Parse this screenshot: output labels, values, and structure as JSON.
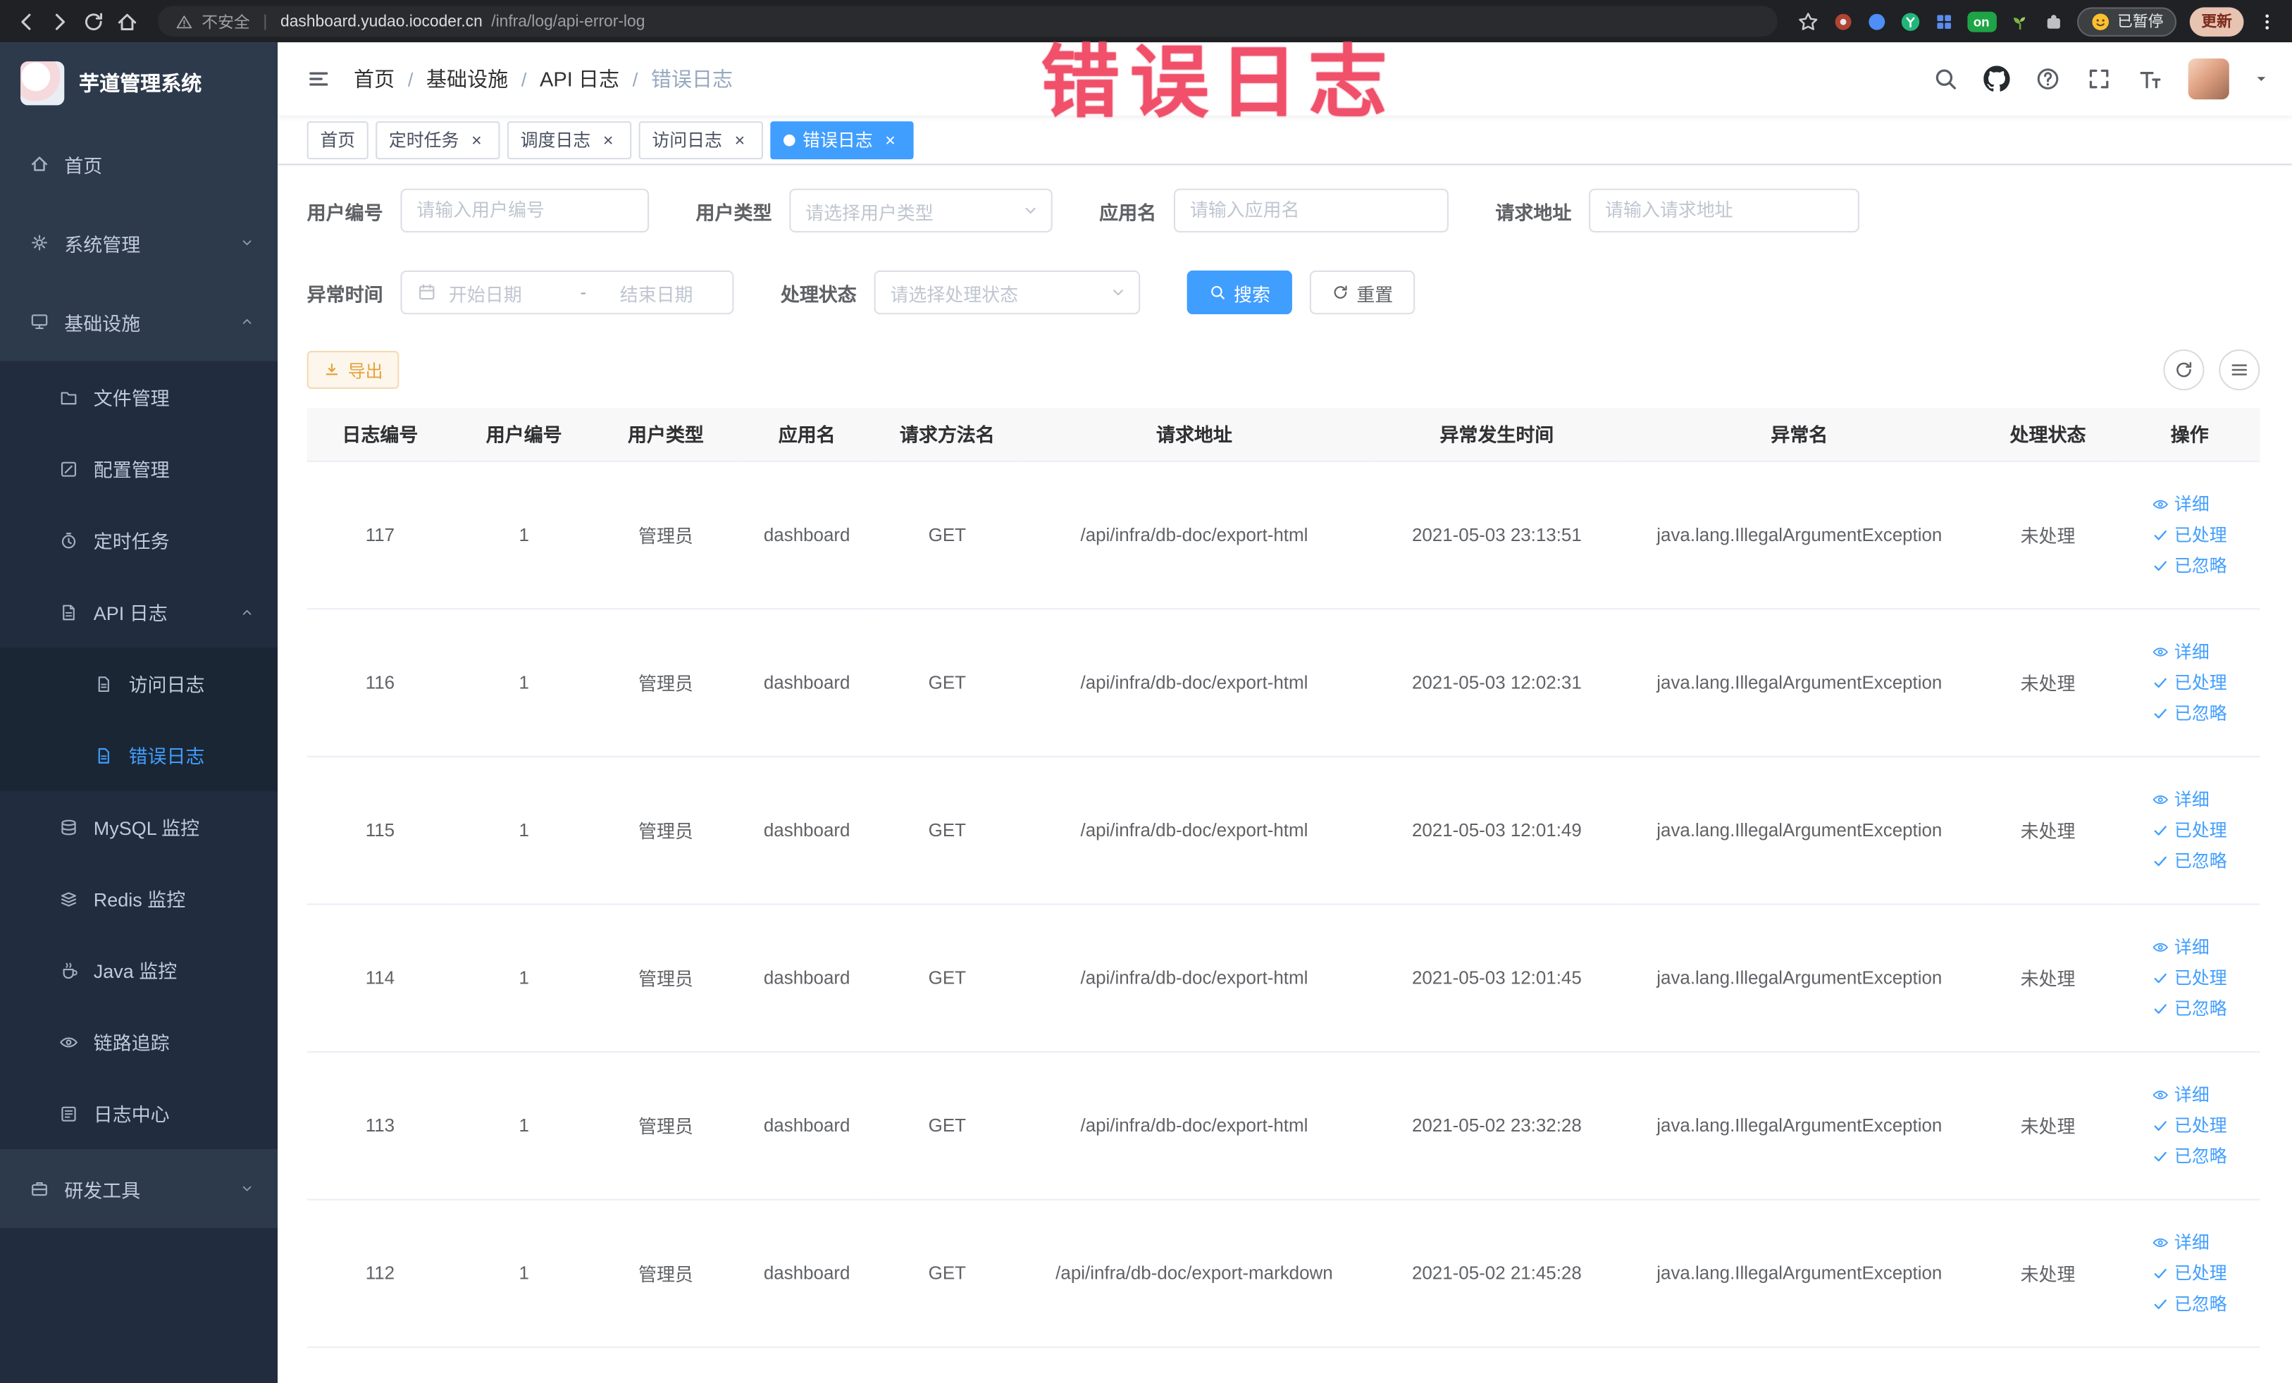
{
  "browser": {
    "security_label": "不安全",
    "url_domain": "dashboard.yudao.iocoder.cn",
    "url_path": "/infra/log/api-error-log",
    "url_separator": "|",
    "extensions_badge_on": "on",
    "paused_chip_label": "已暂停",
    "update_chip_label": "更新"
  },
  "annotation_text": "错误日志",
  "sidebar": {
    "logo_title": "芋道管理系统",
    "menu": [
      {
        "name": "home",
        "label": "首页",
        "icon": "home-icon",
        "level": 1,
        "expandable": false
      },
      {
        "name": "system-mgmt",
        "label": "系统管理",
        "icon": "gear-icon",
        "level": 1,
        "expandable": true,
        "expanded": false
      },
      {
        "name": "infrastructure",
        "label": "基础设施",
        "icon": "infra-icon",
        "level": 1,
        "expandable": true,
        "expanded": true
      },
      {
        "name": "file-mgmt",
        "label": "文件管理",
        "icon": "file-icon",
        "level": 2
      },
      {
        "name": "config-mgmt",
        "label": "配置管理",
        "icon": "config-icon",
        "level": 2
      },
      {
        "name": "scheduled-tasks",
        "label": "定时任务",
        "icon": "timer-icon",
        "level": 2
      },
      {
        "name": "api-log",
        "label": "API 日志",
        "icon": "api-log-icon",
        "level": 2,
        "expandable": true,
        "expanded": true
      },
      {
        "name": "access-log",
        "label": "访问日志",
        "icon": "doc-icon",
        "level": 3
      },
      {
        "name": "error-log",
        "label": "错误日志",
        "icon": "doc-icon",
        "level": 3,
        "active": true
      },
      {
        "name": "mysql-monitor",
        "label": "MySQL 监控",
        "icon": "mysql-icon",
        "level": 2
      },
      {
        "name": "redis-monitor",
        "label": "Redis 监控",
        "icon": "redis-icon",
        "level": 2
      },
      {
        "name": "java-monitor",
        "label": "Java 监控",
        "icon": "java-icon",
        "level": 2
      },
      {
        "name": "trace",
        "label": "链路追踪",
        "icon": "trace-icon",
        "level": 2
      },
      {
        "name": "log-center",
        "label": "日志中心",
        "icon": "log-center-icon",
        "level": 2
      },
      {
        "name": "dev-tools",
        "label": "研发工具",
        "icon": "tools-icon",
        "level": 1,
        "expandable": true,
        "expanded": false
      }
    ]
  },
  "header": {
    "breadcrumb": [
      "首页",
      "基础设施",
      "API 日志",
      "错误日志"
    ],
    "breadcrumb_separator": "/"
  },
  "tabs": [
    {
      "name": "home",
      "label": "首页",
      "closable": false,
      "active": false
    },
    {
      "name": "scheduled-tasks",
      "label": "定时任务",
      "closable": true,
      "active": false
    },
    {
      "name": "schedule-log",
      "label": "调度日志",
      "closable": true,
      "active": false
    },
    {
      "name": "access-log",
      "label": "访问日志",
      "closable": true,
      "active": false
    },
    {
      "name": "error-log",
      "label": "错误日志",
      "closable": true,
      "active": true
    }
  ],
  "filters": {
    "user_id": {
      "label": "用户编号",
      "placeholder": "请输入用户编号",
      "value": ""
    },
    "user_type": {
      "label": "用户类型",
      "placeholder": "请选择用户类型",
      "value": ""
    },
    "app_name": {
      "label": "应用名",
      "placeholder": "请输入应用名",
      "value": ""
    },
    "request_url": {
      "label": "请求地址",
      "placeholder": "请输入请求地址",
      "value": ""
    },
    "exception_time": {
      "label": "异常时间",
      "start_placeholder": "开始日期",
      "separator": "-",
      "end_placeholder": "结束日期"
    },
    "process_status": {
      "label": "处理状态",
      "placeholder": "请选择处理状态",
      "value": ""
    },
    "search_button": "搜索",
    "reset_button": "重置"
  },
  "toolbar": {
    "export_button": "导出"
  },
  "table": {
    "columns": [
      "日志编号",
      "用户编号",
      "用户类型",
      "应用名",
      "请求方法名",
      "请求地址",
      "异常发生时间",
      "异常名",
      "处理状态",
      "操作"
    ],
    "rows": [
      {
        "log_id": "117",
        "user_id": "1",
        "user_type": "管理员",
        "app_name": "dashboard",
        "method": "GET",
        "url": "/api/infra/db-doc/export-html",
        "time": "2021-05-03 23:13:51",
        "exception": "java.lang.IllegalArgumentException",
        "status": "未处理"
      },
      {
        "log_id": "116",
        "user_id": "1",
        "user_type": "管理员",
        "app_name": "dashboard",
        "method": "GET",
        "url": "/api/infra/db-doc/export-html",
        "time": "2021-05-03 12:02:31",
        "exception": "java.lang.IllegalArgumentException",
        "status": "未处理"
      },
      {
        "log_id": "115",
        "user_id": "1",
        "user_type": "管理员",
        "app_name": "dashboard",
        "method": "GET",
        "url": "/api/infra/db-doc/export-html",
        "time": "2021-05-03 12:01:49",
        "exception": "java.lang.IllegalArgumentException",
        "status": "未处理"
      },
      {
        "log_id": "114",
        "user_id": "1",
        "user_type": "管理员",
        "app_name": "dashboard",
        "method": "GET",
        "url": "/api/infra/db-doc/export-html",
        "time": "2021-05-03 12:01:45",
        "exception": "java.lang.IllegalArgumentException",
        "status": "未处理"
      },
      {
        "log_id": "113",
        "user_id": "1",
        "user_type": "管理员",
        "app_name": "dashboard",
        "method": "GET",
        "url": "/api/infra/db-doc/export-html",
        "time": "2021-05-02 23:32:28",
        "exception": "java.lang.IllegalArgumentException",
        "status": "未处理"
      },
      {
        "log_id": "112",
        "user_id": "1",
        "user_type": "管理员",
        "app_name": "dashboard",
        "method": "GET",
        "url": "/api/infra/db-doc/export-markdown",
        "time": "2021-05-02 21:45:28",
        "exception": "java.lang.IllegalArgumentException",
        "status": "未处理"
      }
    ],
    "row_actions": [
      {
        "name": "detail",
        "label": "详细",
        "icon": "eye-icon"
      },
      {
        "name": "processed",
        "label": "已处理",
        "icon": "check-icon"
      },
      {
        "name": "ignored",
        "label": "已忽略",
        "icon": "check-icon"
      }
    ]
  }
}
